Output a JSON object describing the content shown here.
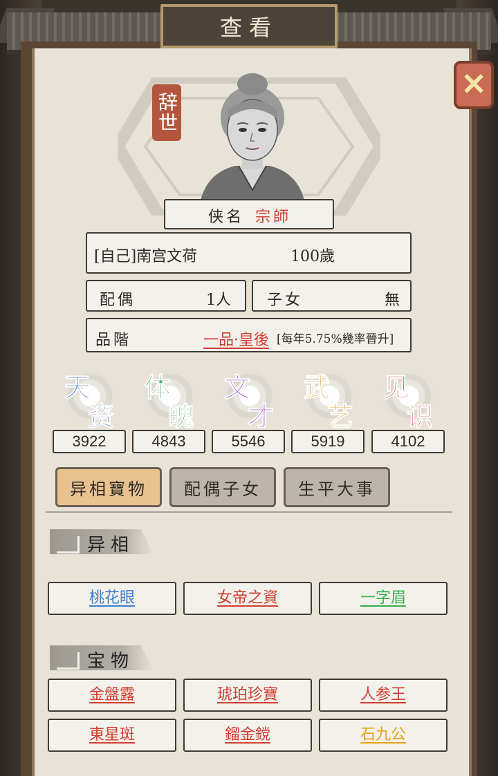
{
  "header": {
    "title": "查看"
  },
  "close_label": "✕",
  "profile": {
    "status": "辞世",
    "hero_name_label": "侠名",
    "hero_name": "宗師",
    "identity": "[自己]南宫文荷",
    "age": "100歲",
    "spouse_label": "配偶",
    "spouse_value": "1人",
    "children_label": "子女",
    "children_value": "無",
    "rank_label": "品階",
    "rank_value": "一品·皇後",
    "rank_note": "[每年5.75%幾率晉升]"
  },
  "stats": [
    {
      "c1": "天",
      "c2": "资",
      "value": "3922",
      "color": "#3a6fd8"
    },
    {
      "c1": "体",
      "c2": "魄",
      "value": "4843",
      "color": "#3aa85a"
    },
    {
      "c1": "文",
      "c2": "才",
      "value": "5546",
      "color": "#a240c8"
    },
    {
      "c1": "武",
      "c2": "艺",
      "value": "5919",
      "color": "#e0a020"
    },
    {
      "c1": "见",
      "c2": "识",
      "value": "4102",
      "color": "#d84a4a"
    }
  ],
  "tabs": [
    {
      "label": "异相寶物",
      "active": true
    },
    {
      "label": "配偶子女",
      "active": false
    },
    {
      "label": "生平大事",
      "active": false
    }
  ],
  "traits": {
    "title": "异相",
    "items": [
      {
        "label": "桃花眼",
        "color": "#3b7fd0"
      },
      {
        "label": "女帝之資",
        "color": "#d23d2f"
      },
      {
        "label": "一字眉",
        "color": "#35b04a"
      }
    ]
  },
  "treasures": {
    "title": "宝物",
    "items": [
      {
        "label": "金盤露",
        "color": "#d23d2f"
      },
      {
        "label": "琥珀珍寶",
        "color": "#d23d2f"
      },
      {
        "label": "人参王",
        "color": "#d23d2f"
      },
      {
        "label": "東星斑",
        "color": "#d23d2f"
      },
      {
        "label": "鎦金鎲",
        "color": "#d23d2f"
      },
      {
        "label": "石九公",
        "color": "#e6a31a"
      }
    ]
  }
}
